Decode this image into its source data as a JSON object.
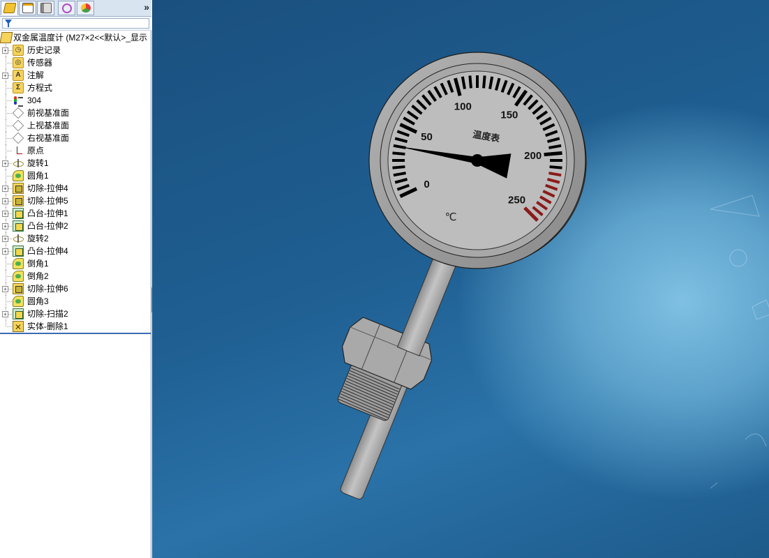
{
  "panel": {
    "tabs": [
      {
        "name": "feature-manager"
      },
      {
        "name": "property-manager"
      },
      {
        "name": "configuration-manager"
      },
      {
        "name": "dimxpert-manager"
      },
      {
        "name": "display-manager"
      }
    ],
    "collapse_label": "»",
    "filter_placeholder": ""
  },
  "tree": {
    "root_label": "双金属温度计  (M27×2<<默认>_显示",
    "items": [
      {
        "label": "历史记录",
        "icon": "history-folder-icon",
        "expandable": true
      },
      {
        "label": "传感器",
        "icon": "sensor-folder-icon",
        "expandable": false
      },
      {
        "label": "注解",
        "icon": "annotation-folder-icon",
        "expandable": true
      },
      {
        "label": "方程式",
        "icon": "equation-folder-icon",
        "expandable": false
      },
      {
        "label": "304",
        "icon": "material-icon",
        "expandable": false
      },
      {
        "label": "前视基准面",
        "icon": "plane-icon",
        "expandable": false
      },
      {
        "label": "上视基准面",
        "icon": "plane-icon",
        "expandable": false
      },
      {
        "label": "右视基准面",
        "icon": "plane-icon",
        "expandable": false
      },
      {
        "label": "原点",
        "icon": "origin-icon",
        "expandable": false
      },
      {
        "label": "旋转1",
        "icon": "revolve-icon",
        "expandable": true
      },
      {
        "label": "圆角1",
        "icon": "fillet-icon",
        "expandable": false
      },
      {
        "label": "切除-拉伸4",
        "icon": "cut-extrude-icon",
        "expandable": true
      },
      {
        "label": "切除-拉伸5",
        "icon": "cut-extrude-icon",
        "expandable": true
      },
      {
        "label": "凸台-拉伸1",
        "icon": "boss-extrude-icon",
        "expandable": true
      },
      {
        "label": "凸台-拉伸2",
        "icon": "boss-extrude-icon",
        "expandable": true
      },
      {
        "label": "旋转2",
        "icon": "revolve-icon",
        "expandable": true
      },
      {
        "label": "凸台-拉伸4",
        "icon": "boss-extrude-icon",
        "expandable": true
      },
      {
        "label": "倒角1",
        "icon": "chamfer-icon",
        "expandable": false
      },
      {
        "label": "倒角2",
        "icon": "chamfer-icon",
        "expandable": false
      },
      {
        "label": "切除-拉伸6",
        "icon": "cut-extrude-icon",
        "expandable": true
      },
      {
        "label": "圆角3",
        "icon": "fillet-icon",
        "expandable": false
      },
      {
        "label": "切除-扫描2",
        "icon": "cut-sweep-icon",
        "expandable": true
      },
      {
        "label": "实体-删除1",
        "icon": "delete-body-icon",
        "expandable": false
      }
    ]
  },
  "gauge": {
    "dial_title": "温度表",
    "unit": "℃",
    "scale_labels": [
      "0",
      "50",
      "100",
      "150",
      "200",
      "250"
    ],
    "scale_min": 0,
    "scale_max": 250,
    "reading": 35,
    "redzone_color": "#8b1a1a",
    "accent": "#1f5fbf"
  }
}
